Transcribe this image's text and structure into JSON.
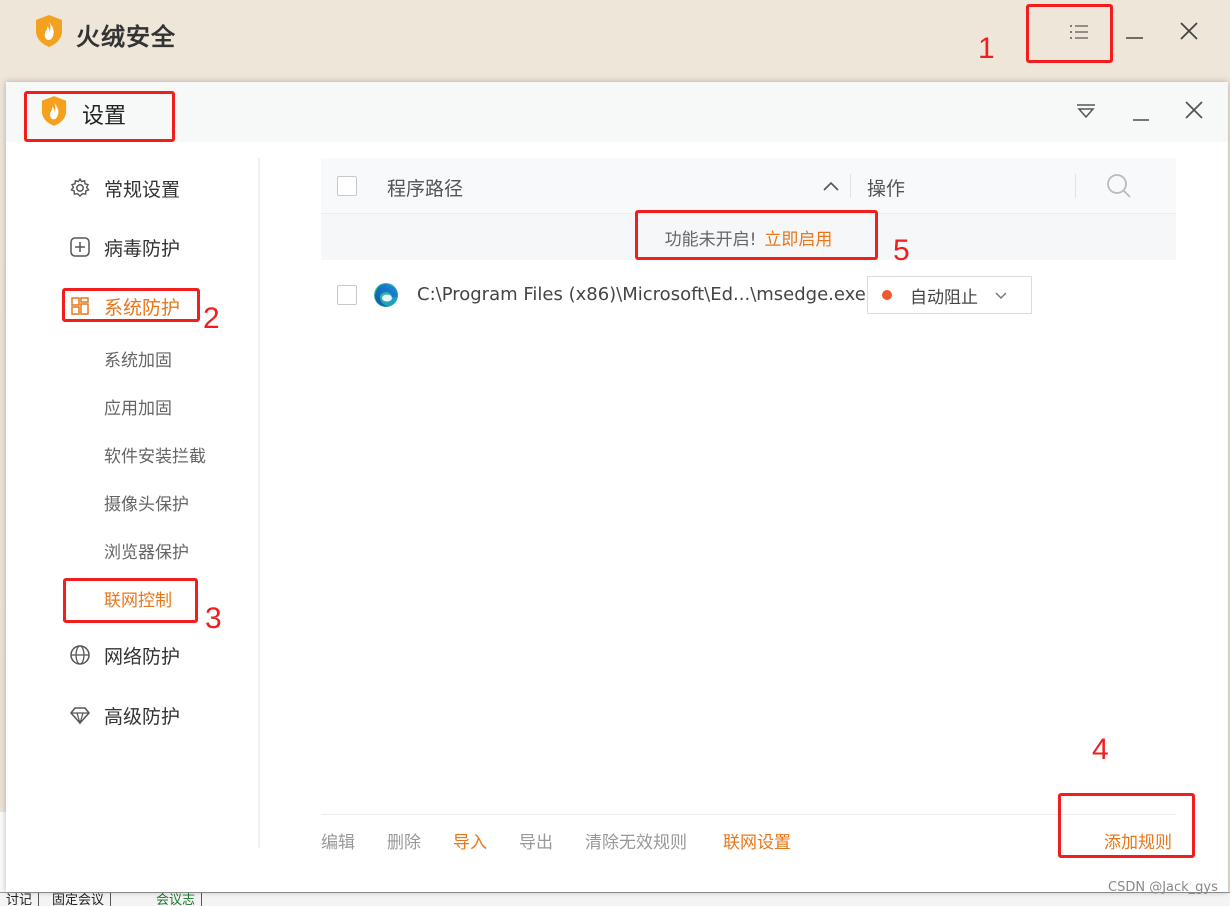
{
  "background_app": {
    "title": "火绒安全",
    "bottom_tabs": [
      "讨记",
      "固定会议",
      "会议志"
    ]
  },
  "settings_window": {
    "title": "设置"
  },
  "sidebar": {
    "items": [
      {
        "label": "常规设置",
        "icon": "gear-icon"
      },
      {
        "label": "病毒防护",
        "icon": "plus-box-icon"
      },
      {
        "label": "系统防护",
        "icon": "grid-icon",
        "active": true
      },
      {
        "label": "网络防护",
        "icon": "globe-icon"
      },
      {
        "label": "高级防护",
        "icon": "diamond-icon"
      }
    ],
    "sub_items": [
      "系统加固",
      "应用加固",
      "软件安装拦截",
      "摄像头保护",
      "浏览器保护",
      "联网控制"
    ],
    "active_sub_item": "联网控制"
  },
  "table": {
    "headers": {
      "path": "程序路径",
      "operation": "操作"
    },
    "notice": {
      "message": "功能未开启!",
      "link": "立即启用"
    },
    "rows": [
      {
        "path": "C:\\Program Files (x86)\\Microsoft\\Ed...\\msedge.exe",
        "action": "自动阻止"
      }
    ]
  },
  "footer": {
    "edit": "编辑",
    "delete": "删除",
    "import": "导入",
    "export": "导出",
    "clear_invalid": "清除无效规则",
    "network_settings": "联网设置",
    "add_rule": "添加规则"
  },
  "annotations": [
    "1",
    "2",
    "3",
    "4",
    "5"
  ],
  "watermark": "CSDN @Jack_gys",
  "colors": {
    "accent": "#e8771a",
    "annotation_red": "#f21d1d",
    "status_dot": "#f05a28"
  }
}
